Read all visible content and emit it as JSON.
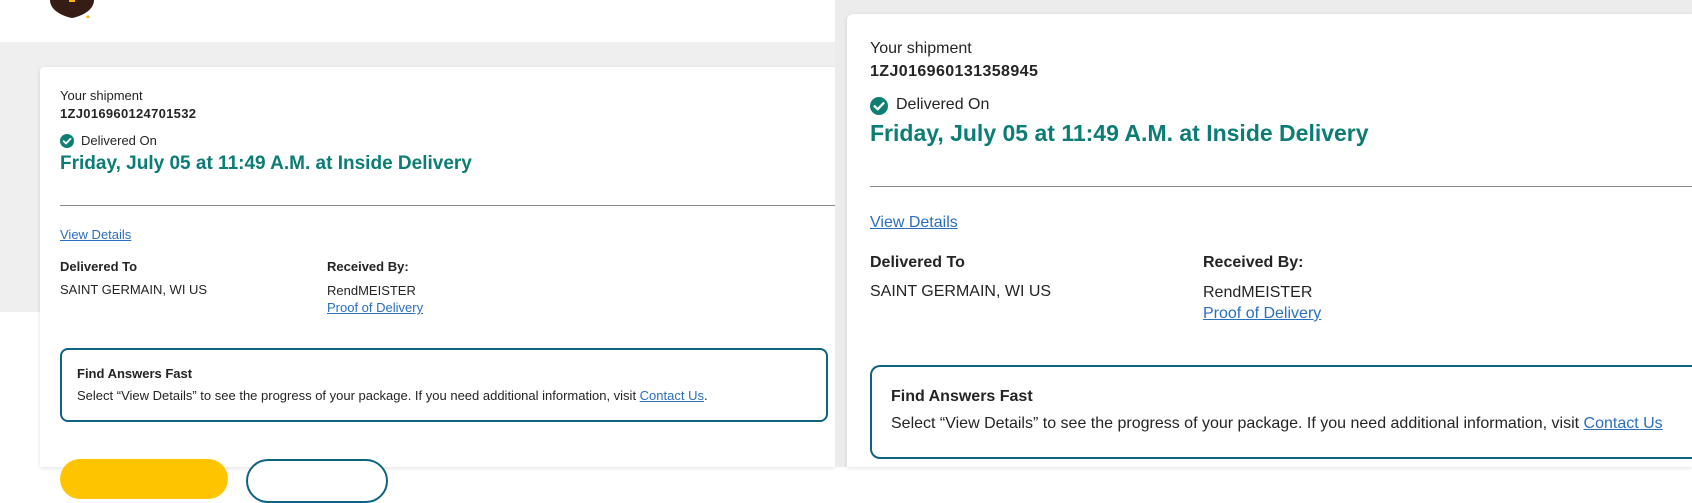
{
  "left_panel": {
    "your_shipment_label": "Your shipment",
    "tracking_number": "1ZJ016960124701532",
    "status_label": "Delivered On",
    "delivery_datetime": "Friday, July 05 at 11:49 A.M. at Inside Delivery",
    "view_details_link": "View Details",
    "delivered_to_heading": "Delivered To",
    "delivered_to_value": "SAINT GERMAIN, WI US",
    "received_by_heading": "Received By:",
    "received_by_value": "RendMEISTER",
    "proof_link": "Proof of Delivery",
    "answers_title": "Find Answers Fast",
    "answers_text": "Select “View Details” to see the progress of your package. If you need additional information, visit ",
    "contact_link": "Contact Us",
    "answers_period": "."
  },
  "right_panel": {
    "your_shipment_label": "Your shipment",
    "tracking_number": "1ZJ016960131358945",
    "status_label": "Delivered On",
    "delivery_datetime": "Friday, July 05 at 11:49 A.M. at Inside Delivery",
    "view_details_link": "View Details",
    "delivered_to_heading": "Delivered To",
    "delivered_to_value": "SAINT GERMAIN, WI US",
    "received_by_heading": "Received By:",
    "received_by_value": "RendMEISTER",
    "proof_link": "Proof of Delivery",
    "answers_title": "Find Answers Fast",
    "answers_text": "Select “View Details” to see the progress of your package. If you need additional information, visit ",
    "contact_link": "Contact Us"
  },
  "colors": {
    "accent_teal": "#0b7d74",
    "link_blue": "#2a6fbd",
    "border_navy": "#0e6381",
    "brand_brown": "#351c15",
    "brand_gold": "#ffb500",
    "button_yellow": "#ffc400"
  },
  "icons": {
    "logo": "ups-shield-logo",
    "status": "check-circle-icon"
  }
}
